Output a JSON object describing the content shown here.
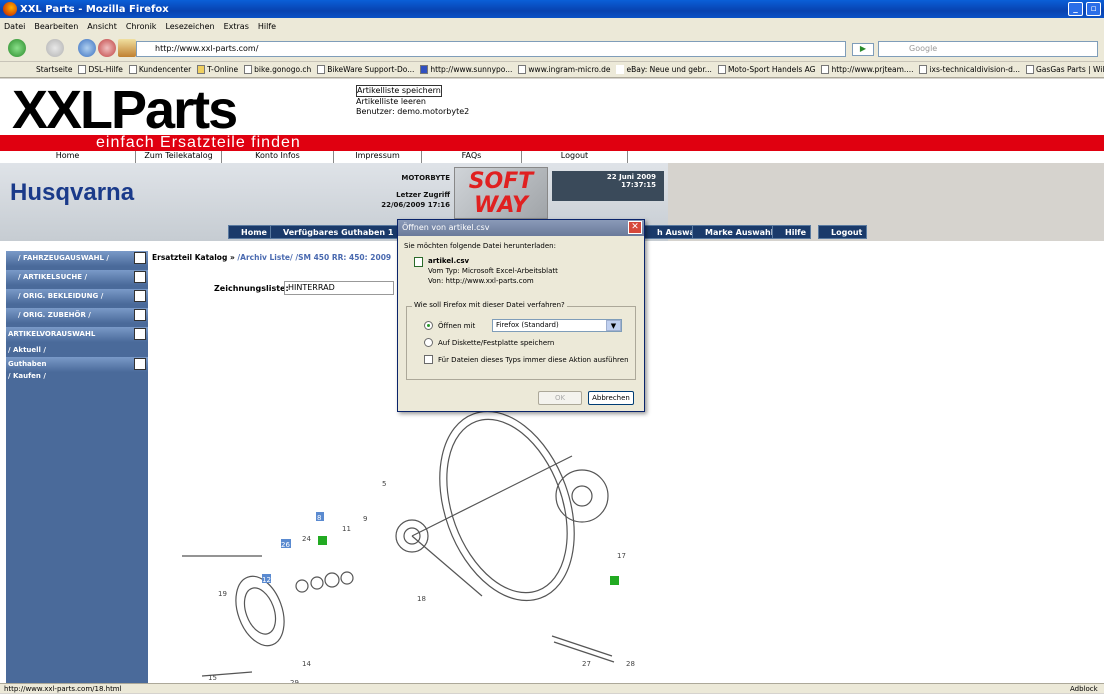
{
  "window": {
    "title": "XXL Parts - Mozilla Firefox"
  },
  "menu": [
    "Datei",
    "Bearbeiten",
    "Ansicht",
    "Chronik",
    "Lesezeichen",
    "Extras",
    "Hilfe"
  ],
  "address": {
    "url": "http://www.xxl-parts.com/",
    "search_placeholder": "Google"
  },
  "bookmarks": [
    "Startseite",
    "DSL-Hilfe",
    "Kundencenter",
    "T-Online",
    "bike.gonogo.ch",
    "BikeWare Support-Do...",
    "http://www.sunnypo...",
    "www.ingram-micro.de",
    "eBay: Neue und gebr...",
    "Moto-Sport Handels AG",
    "http://www.prjteam....",
    "ixs-technicaldivision-d...",
    "GasGas Parts | Wilko..."
  ],
  "site": {
    "logo": "XXLParts",
    "slogan": "einfach Ersatzteile finden",
    "article_links": [
      "Artikelliste speichern",
      "Artikelliste leeren",
      "Benutzer: demo.motorbyte2"
    ],
    "topnav": [
      "Home",
      "Zum Teilekatalog",
      "Konto Infos",
      "Impressum",
      "FAQs",
      "Logout"
    ],
    "brand": "Husqvarna",
    "user": {
      "name": "MOTORBYTE",
      "last_access_label": "Letzer Zugriff",
      "last_access": "22/06/2009 17:16"
    },
    "date": "22 Juni 2009",
    "time": "17:37:15",
    "softway": "SOFT WAY",
    "buttons": [
      "Home",
      "Verfügbares Guthaben 1",
      "h Auswahl",
      "Marke Auswahl",
      "Hilfe",
      "Logout"
    ],
    "sidebar": [
      "/ FAHRZEUGAUSWAHL /",
      "/ ARTIKELSUCHE /",
      "/ ORIG. BEKLEIDUNG /",
      "/ ORIG. ZUBEHÖR /",
      "ARTIKELVORAUSWAHL"
    ],
    "sidebar_sub": [
      "/ Aktuell /",
      "Guthaben",
      "/ Kaufen /"
    ],
    "breadcrumb": {
      "prefix": "Ersatzteil Katalog »",
      "path": "/Archiv Liste/ /SM 450 RR: 450: 2009"
    },
    "drawing_label": "Zeichnungsliste:",
    "drawing_value": "HINTERRAD",
    "part_numbers": [
      "5",
      "8",
      "9",
      "11",
      "12",
      "14",
      "15",
      "17",
      "18",
      "19",
      "24",
      "26",
      "27",
      "28",
      "29"
    ]
  },
  "dialog": {
    "title": "Öffnen von artikel.csv",
    "intro": "Sie möchten folgende Datei herunterladen:",
    "filename": "artikel.csv",
    "type_line": "Vom Typ:  Microsoft Excel-Arbeitsblatt",
    "from_line": "Von:  http://www.xxl-parts.com",
    "group_label": "Wie soll Firefox mit dieser Datei verfahren?",
    "open_label": "Öffnen mit",
    "open_app": "Firefox (Standard)",
    "save_label": "Auf Diskette/Festplatte speichern",
    "always_label": "Für Dateien dieses Typs immer diese Aktion ausführen",
    "ok": "OK",
    "cancel": "Abbrechen"
  },
  "status": {
    "url": "http://www.xxl-parts.com/18.html",
    "addon": "Adblock"
  }
}
